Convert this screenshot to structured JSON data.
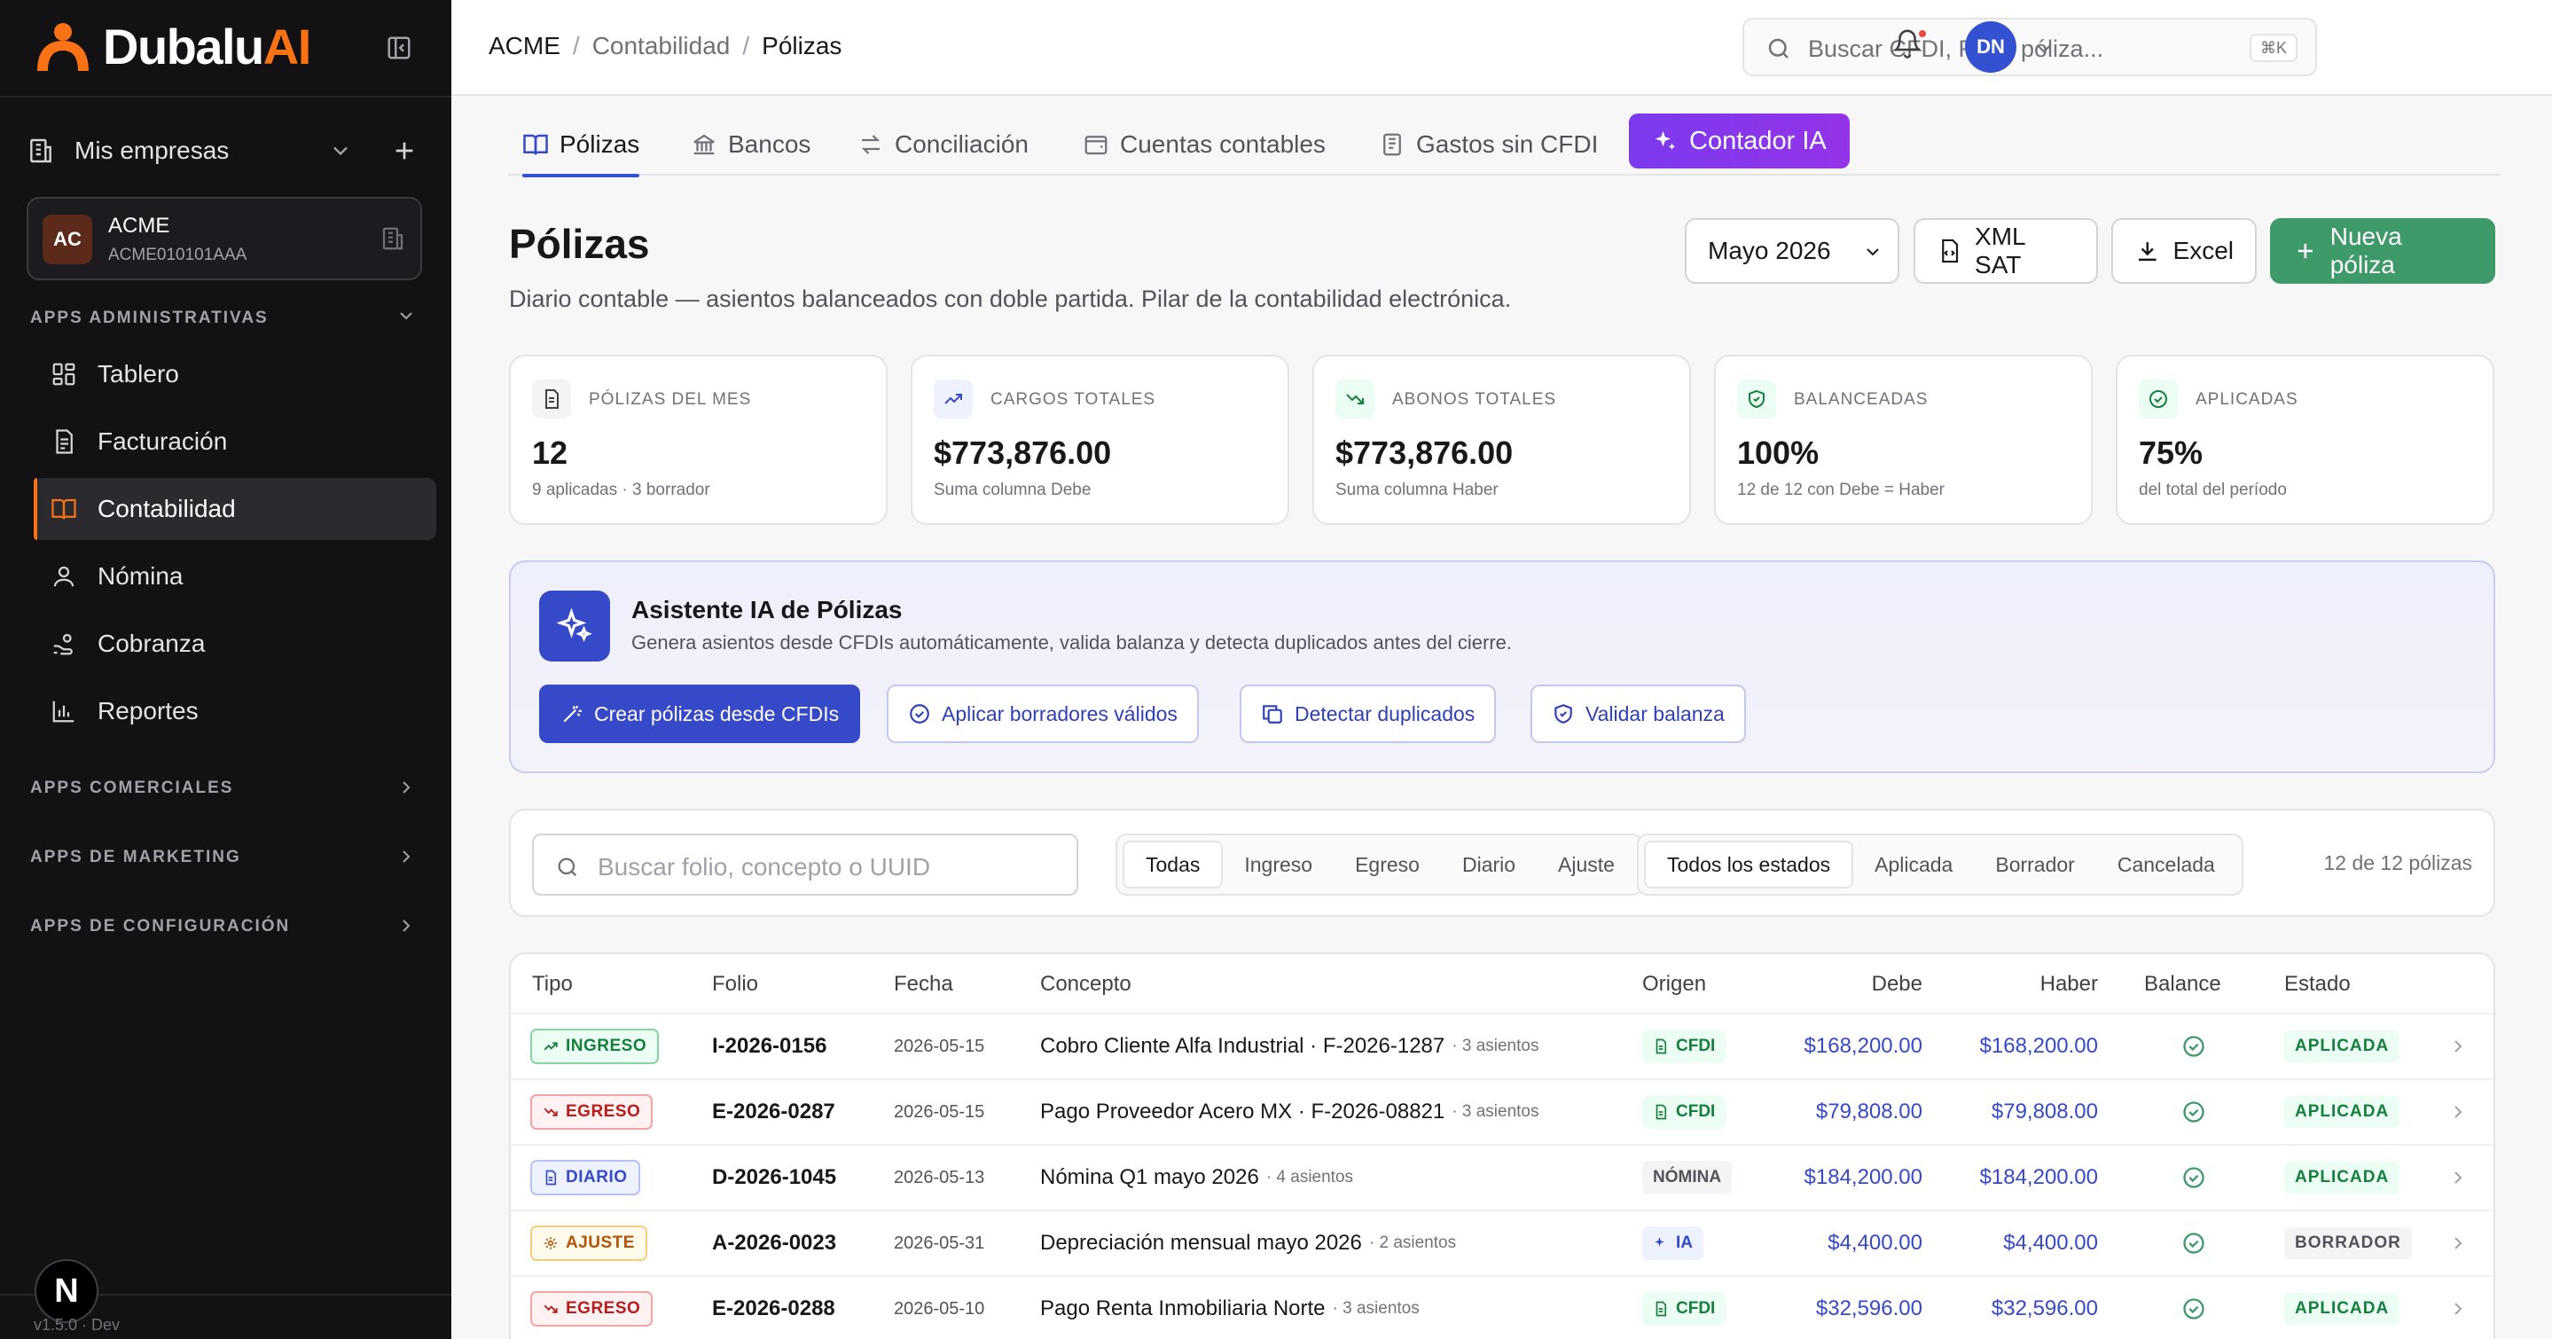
{
  "brand": {
    "name_main": "Dubalu",
    "name_accent": "AI"
  },
  "sidebar": {
    "companies_label": "Mis empresas",
    "company": {
      "initials": "AC",
      "name": "ACME",
      "rfc": "ACME010101AAA"
    },
    "sections": {
      "admin": "APPS ADMINISTRATIVAS",
      "comerciales": "APPS COMERCIALES",
      "marketing": "APPS DE MARKETING",
      "config": "APPS DE CONFIGURACIÓN"
    },
    "items": [
      {
        "label": "Tablero",
        "icon": "dashboard-icon"
      },
      {
        "label": "Facturación",
        "icon": "invoice-icon"
      },
      {
        "label": "Contabilidad",
        "icon": "book-icon",
        "active": true
      },
      {
        "label": "Nómina",
        "icon": "user-icon"
      },
      {
        "label": "Cobranza",
        "icon": "hand-coins-icon"
      },
      {
        "label": "Reportes",
        "icon": "bar-chart-icon"
      }
    ],
    "version": "v1.5.0 · Dev",
    "dev_badge": "N"
  },
  "header": {
    "breadcrumb": [
      "ACME",
      "Contabilidad",
      "Pólizas"
    ],
    "search_placeholder": "Buscar CFDI, RFC, póliza...",
    "search_shortcut": "⌘K",
    "user_initials": "DN"
  },
  "tabs": [
    {
      "label": "Pólizas",
      "active": true
    },
    {
      "label": "Bancos"
    },
    {
      "label": "Conciliación"
    },
    {
      "label": "Cuentas contables"
    },
    {
      "label": "Gastos sin CFDI"
    },
    {
      "label": "Contador IA"
    }
  ],
  "page": {
    "title": "Pólizas",
    "subtitle": "Diario contable — asientos balanceados con doble partida. Pilar de la contabilidad electrónica.",
    "period": "Mayo 2026",
    "xml_label": "XML SAT",
    "excel_label": "Excel",
    "new_label": "Nueva póliza"
  },
  "stats": [
    {
      "label": "PÓLIZAS DEL MES",
      "value": "12",
      "note": "9 aplicadas · 3 borrador"
    },
    {
      "label": "CARGOS TOTALES",
      "value": "$773,876.00",
      "note": "Suma columna Debe"
    },
    {
      "label": "ABONOS TOTALES",
      "value": "$773,876.00",
      "note": "Suma columna Haber"
    },
    {
      "label": "BALANCEADAS",
      "value": "100%",
      "note": "12 de 12 con Debe = Haber"
    },
    {
      "label": "APLICADAS",
      "value": "75%",
      "note": "del total del período"
    }
  ],
  "assistant": {
    "title": "Asistente IA de Pólizas",
    "subtitle": "Genera asientos desde CFDIs automáticamente, valida balanza y detecta duplicados antes del cierre.",
    "actions": [
      "Crear pólizas desde CFDIs",
      "Aplicar borradores válidos",
      "Detectar duplicados",
      "Validar balanza"
    ]
  },
  "filters": {
    "search_placeholder": "Buscar folio, concepto o UUID",
    "types": [
      "Todas",
      "Ingreso",
      "Egreso",
      "Diario",
      "Ajuste"
    ],
    "states": [
      "Todos los estados",
      "Aplicada",
      "Borrador",
      "Cancelada"
    ],
    "count": "12 de 12 pólizas"
  },
  "table": {
    "headers": {
      "tipo": "Tipo",
      "folio": "Folio",
      "fecha": "Fecha",
      "concepto": "Concepto",
      "origen": "Origen",
      "debe": "Debe",
      "haber": "Haber",
      "balance": "Balance",
      "estado": "Estado"
    },
    "rows": [
      {
        "tipo": "INGRESO",
        "folio": "I-2026-0156",
        "fecha": "2026-05-15",
        "concepto": "Cobro Cliente Alfa Industrial · F-2026-1287",
        "asientos": "· 3 asientos",
        "origen": "CFDI",
        "debe": "$168,200.00",
        "haber": "$168,200.00",
        "estado": "APLICADA"
      },
      {
        "tipo": "EGRESO",
        "folio": "E-2026-0287",
        "fecha": "2026-05-15",
        "concepto": "Pago Proveedor Acero MX · F-2026-08821",
        "asientos": "· 3 asientos",
        "origen": "CFDI",
        "debe": "$79,808.00",
        "haber": "$79,808.00",
        "estado": "APLICADA"
      },
      {
        "tipo": "DIARIO",
        "folio": "D-2026-1045",
        "fecha": "2026-05-13",
        "concepto": "Nómina Q1 mayo 2026",
        "asientos": "· 4 asientos",
        "origen": "NÓMINA",
        "debe": "$184,200.00",
        "haber": "$184,200.00",
        "estado": "APLICADA"
      },
      {
        "tipo": "AJUSTE",
        "folio": "A-2026-0023",
        "fecha": "2026-05-31",
        "concepto": "Depreciación mensual mayo 2026",
        "asientos": "· 2 asientos",
        "origen": "IA",
        "debe": "$4,400.00",
        "haber": "$4,400.00",
        "estado": "BORRADOR"
      },
      {
        "tipo": "EGRESO",
        "folio": "E-2026-0288",
        "fecha": "2026-05-10",
        "concepto": "Pago Renta Inmobiliaria Norte",
        "asientos": "· 3 asientos",
        "origen": "CFDI",
        "debe": "$32,596.00",
        "haber": "$32,596.00",
        "estado": "APLICADA"
      }
    ]
  },
  "colors": {
    "accent": "#f97316",
    "primary": "#3649c9",
    "success": "#3f9a6a",
    "ai": "#7c3aed"
  }
}
